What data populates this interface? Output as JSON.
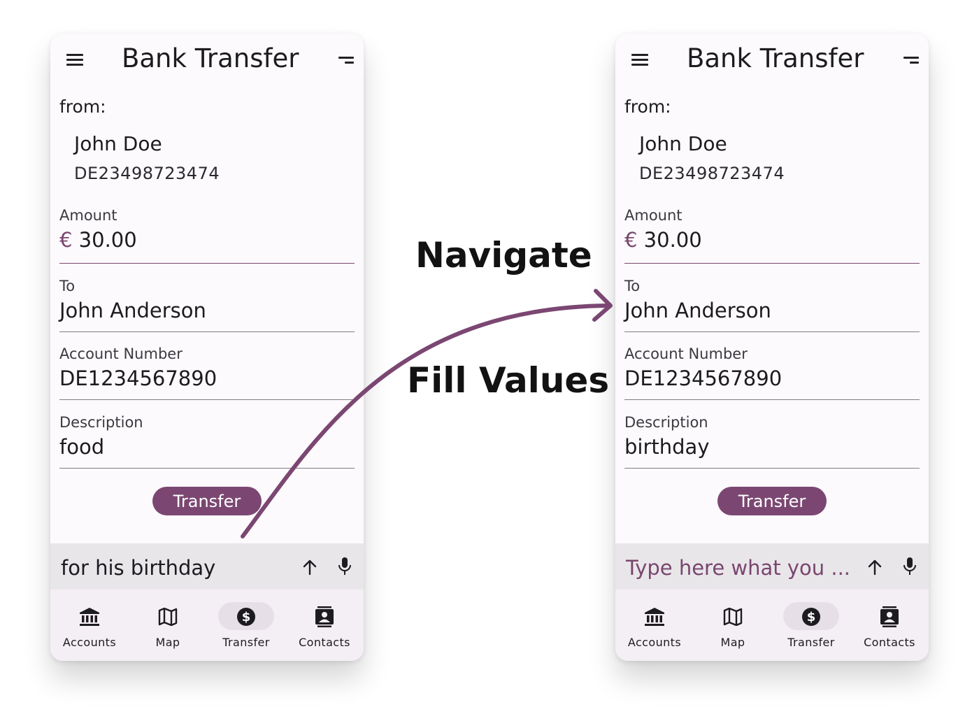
{
  "app": {
    "title": "Bank Transfer"
  },
  "labels": {
    "navigate": "Navigate",
    "fill_values": "Fill Values"
  },
  "left": {
    "from_label": "from:",
    "from_name": "John Doe",
    "from_iban": "DE23498723474",
    "amount_label": "Amount",
    "currency": "€",
    "amount_value": "30.00",
    "to_label": "To",
    "to_value": "John Anderson",
    "account_label": "Account Number",
    "account_value": "DE1234567890",
    "description_label": "Description",
    "description_value": "food",
    "transfer_button": "Transfer",
    "chat_input_value": "for his birthday",
    "nav": [
      {
        "label": "Accounts",
        "icon": "bank-icon"
      },
      {
        "label": "Map",
        "icon": "map-icon"
      },
      {
        "label": "Transfer",
        "icon": "dollar-icon"
      },
      {
        "label": "Contacts",
        "icon": "contacts-icon"
      }
    ]
  },
  "right": {
    "from_label": "from:",
    "from_name": "John Doe",
    "from_iban": "DE23498723474",
    "amount_label": "Amount",
    "currency": "€",
    "amount_value": "30.00",
    "to_label": "To",
    "to_value": "John Anderson",
    "account_label": "Account Number",
    "account_value": "DE1234567890",
    "description_label": "Description",
    "description_value": "birthday",
    "transfer_button": "Transfer",
    "chat_input_placeholder": "Type here what you ...",
    "nav": [
      {
        "label": "Accounts",
        "icon": "bank-icon"
      },
      {
        "label": "Map",
        "icon": "map-icon"
      },
      {
        "label": "Transfer",
        "icon": "dollar-icon"
      },
      {
        "label": "Contacts",
        "icon": "contacts-icon"
      }
    ]
  },
  "colors": {
    "accent": "#7b4772",
    "nav_background": "#f4eff4",
    "input_bar_background": "#e9e6ea",
    "arrow": "#7b4772"
  }
}
